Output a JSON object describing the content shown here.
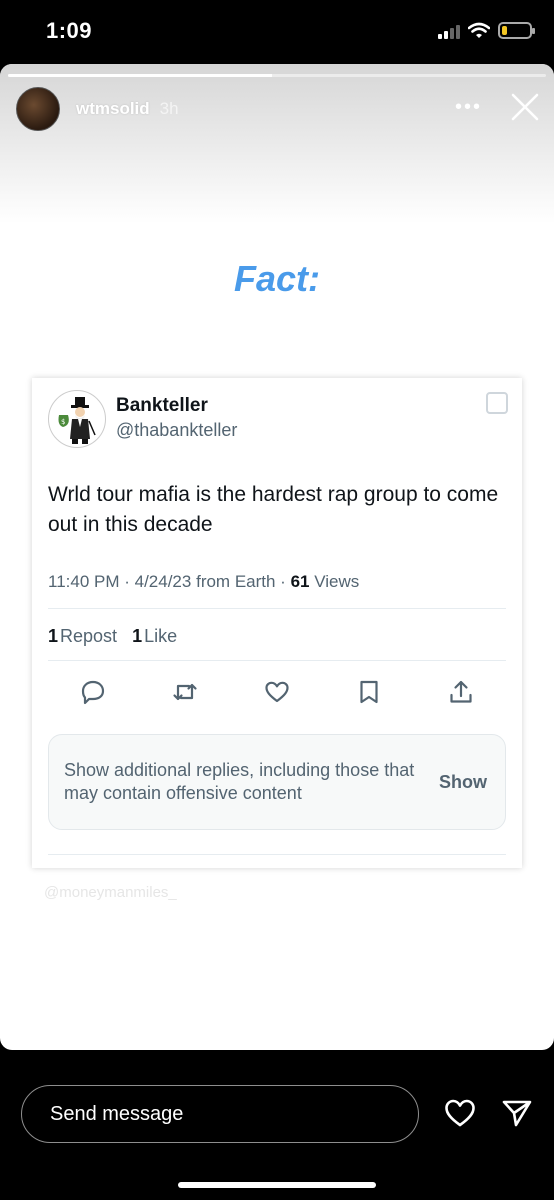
{
  "status_bar": {
    "time": "1:09",
    "battery_level": 0.2,
    "battery_color": "#f3c623"
  },
  "story": {
    "progress": 0.49,
    "username": "wtmsolid",
    "time_ago": "3h",
    "more_icon": "more-horizontal-icon",
    "close_icon": "close-icon",
    "headline": "Fact:",
    "headline_color": "#4a9bea",
    "watermark": "@moneymanmiles_"
  },
  "tweet": {
    "display_name": "Bankteller",
    "handle": "@thabankteller",
    "text": "Wrld tour mafia is the hardest rap group to come out in this decade",
    "time": "11:40 PM",
    "date": "4/24/23",
    "source": "from Earth",
    "views_count": "61",
    "views_label": "Views",
    "reposts_count": "1",
    "reposts_label": "Repost",
    "likes_count": "1",
    "likes_label": "Like",
    "actions": [
      "reply-icon",
      "repost-icon",
      "like-icon",
      "bookmark-icon",
      "share-icon"
    ],
    "replies_notice": "Show additional replies, including those that may contain offensive content",
    "replies_button": "Show"
  },
  "bottom_bar": {
    "message_placeholder": "Send message",
    "heart_icon": "heart-icon",
    "send_icon": "send-icon"
  }
}
